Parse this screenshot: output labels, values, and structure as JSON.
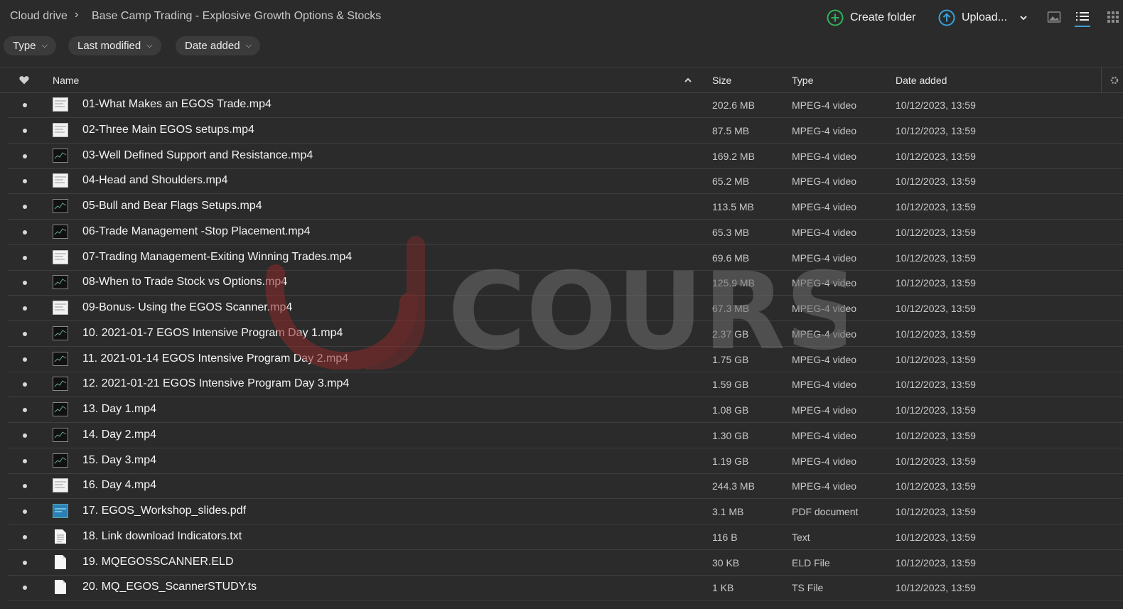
{
  "breadcrumb": {
    "root": "Cloud drive",
    "separator": "›",
    "folder": "Base Camp Trading - Explosive Growth Options & Stocks"
  },
  "toolbar": {
    "create_folder": "Create folder",
    "upload": "Upload...",
    "icons": [
      "create-folder-icon",
      "upload-icon",
      "chevron-down-icon",
      "thumbnail-view-icon",
      "list-view-icon",
      "grid-view-icon"
    ]
  },
  "filters": {
    "type": "Type",
    "last_modified": "Last modified",
    "date_added": "Date added"
  },
  "table": {
    "headers": {
      "name": "Name",
      "size": "Size",
      "type": "Type",
      "date": "Date added"
    },
    "sort": "ascending",
    "rows": [
      {
        "name": "01-What Makes an EGOS Trade.mp4",
        "size": "202.6 MB",
        "type": "MPEG-4 video",
        "date": "10/12/2023, 13:59",
        "thumb": "light"
      },
      {
        "name": "02-Three Main EGOS setups.mp4",
        "size": "87.5 MB",
        "type": "MPEG-4 video",
        "date": "10/12/2023, 13:59",
        "thumb": "light"
      },
      {
        "name": "03-Well Defined Support and Resistance.mp4",
        "size": "169.2 MB",
        "type": "MPEG-4 video",
        "date": "10/12/2023, 13:59",
        "thumb": "dark"
      },
      {
        "name": "04-Head and Shoulders.mp4",
        "size": "65.2 MB",
        "type": "MPEG-4 video",
        "date": "10/12/2023, 13:59",
        "thumb": "light"
      },
      {
        "name": "05-Bull and Bear Flags Setups.mp4",
        "size": "113.5 MB",
        "type": "MPEG-4 video",
        "date": "10/12/2023, 13:59",
        "thumb": "dark"
      },
      {
        "name": "06-Trade Management -Stop Placement.mp4",
        "size": "65.3 MB",
        "type": "MPEG-4 video",
        "date": "10/12/2023, 13:59",
        "thumb": "dark"
      },
      {
        "name": "07-Trading Management-Exiting Winning Trades.mp4",
        "size": "69.6 MB",
        "type": "MPEG-4 video",
        "date": "10/12/2023, 13:59",
        "thumb": "light"
      },
      {
        "name": "08-When to Trade Stock vs Options.mp4",
        "size": "125.9 MB",
        "type": "MPEG-4 video",
        "date": "10/12/2023, 13:59",
        "thumb": "dark"
      },
      {
        "name": "09-Bonus- Using the EGOS Scanner.mp4",
        "size": "67.3 MB",
        "type": "MPEG-4 video",
        "date": "10/12/2023, 13:59",
        "thumb": "light"
      },
      {
        "name": "10. 2021-01-7 EGOS Intensive Program Day 1.mp4",
        "size": "2.37 GB",
        "type": "MPEG-4 video",
        "date": "10/12/2023, 13:59",
        "thumb": "dark"
      },
      {
        "name": "11. 2021-01-14 EGOS Intensive Program Day 2.mp4",
        "size": "1.75 GB",
        "type": "MPEG-4 video",
        "date": "10/12/2023, 13:59",
        "thumb": "dark"
      },
      {
        "name": "12. 2021-01-21 EGOS Intensive Program Day 3.mp4",
        "size": "1.59 GB",
        "type": "MPEG-4 video",
        "date": "10/12/2023, 13:59",
        "thumb": "dark"
      },
      {
        "name": "13. Day 1.mp4",
        "size": "1.08 GB",
        "type": "MPEG-4 video",
        "date": "10/12/2023, 13:59",
        "thumb": "dark"
      },
      {
        "name": "14. Day 2.mp4",
        "size": "1.30 GB",
        "type": "MPEG-4 video",
        "date": "10/12/2023, 13:59",
        "thumb": "dark"
      },
      {
        "name": "15. Day 3.mp4",
        "size": "1.19 GB",
        "type": "MPEG-4 video",
        "date": "10/12/2023, 13:59",
        "thumb": "dark"
      },
      {
        "name": "16. Day 4.mp4",
        "size": "244.3 MB",
        "type": "MPEG-4 video",
        "date": "10/12/2023, 13:59",
        "thumb": "light"
      },
      {
        "name": "17. EGOS_Workshop_slides.pdf",
        "size": "3.1 MB",
        "type": "PDF document",
        "date": "10/12/2023, 13:59",
        "thumb": "blue"
      },
      {
        "name": "18. Link download Indicators.txt",
        "size": "116 B",
        "type": "Text",
        "date": "10/12/2023, 13:59",
        "thumb": "text"
      },
      {
        "name": "19. MQEGOSSCANNER.ELD",
        "size": "30 KB",
        "type": "ELD File",
        "date": "10/12/2023, 13:59",
        "thumb": "blank"
      },
      {
        "name": "20. MQ_EGOS_ScannerSTUDY.ts",
        "size": "1 KB",
        "type": "TS File",
        "date": "10/12/2023, 13:59",
        "thumb": "blank"
      }
    ]
  },
  "watermark": {
    "text": "COURSE"
  },
  "colors": {
    "background": "#2b2b2b",
    "accent": "#3aa0d8",
    "create_folder_accent": "#2fb35a",
    "watermark_red": "#8c2a2a"
  }
}
